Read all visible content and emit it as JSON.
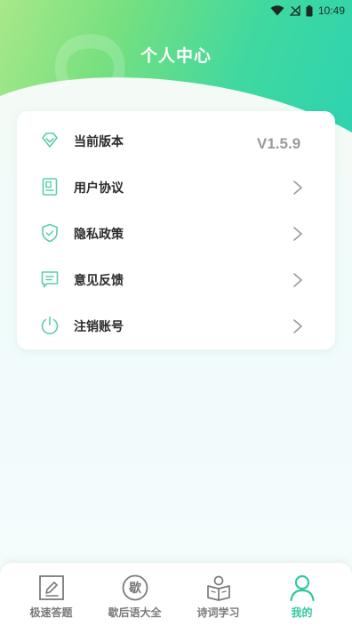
{
  "status_bar": {
    "time": "10:49"
  },
  "header": {
    "title": "个人中心",
    "watermark": "OK"
  },
  "menu": {
    "items": [
      {
        "label": "当前版本",
        "icon": "gem-icon",
        "value": "V1.5.9"
      },
      {
        "label": "用户协议",
        "icon": "document-icon"
      },
      {
        "label": "隐私政策",
        "icon": "shield-icon"
      },
      {
        "label": "意见反馈",
        "icon": "feedback-icon"
      },
      {
        "label": "注销账号",
        "icon": "power-icon"
      }
    ]
  },
  "tabbar": {
    "tabs": [
      {
        "label": "极速答题",
        "icon": "edit-icon",
        "active": false
      },
      {
        "label": "歇后语大全",
        "icon": "xie-badge-icon",
        "badge_char": "歇",
        "active": false
      },
      {
        "label": "诗词学习",
        "icon": "reading-icon",
        "active": false
      },
      {
        "label": "我的",
        "icon": "person-icon",
        "active": true
      }
    ]
  },
  "colors": {
    "accent": "#2fc9a0",
    "icon_line": "#5ccdaa"
  }
}
